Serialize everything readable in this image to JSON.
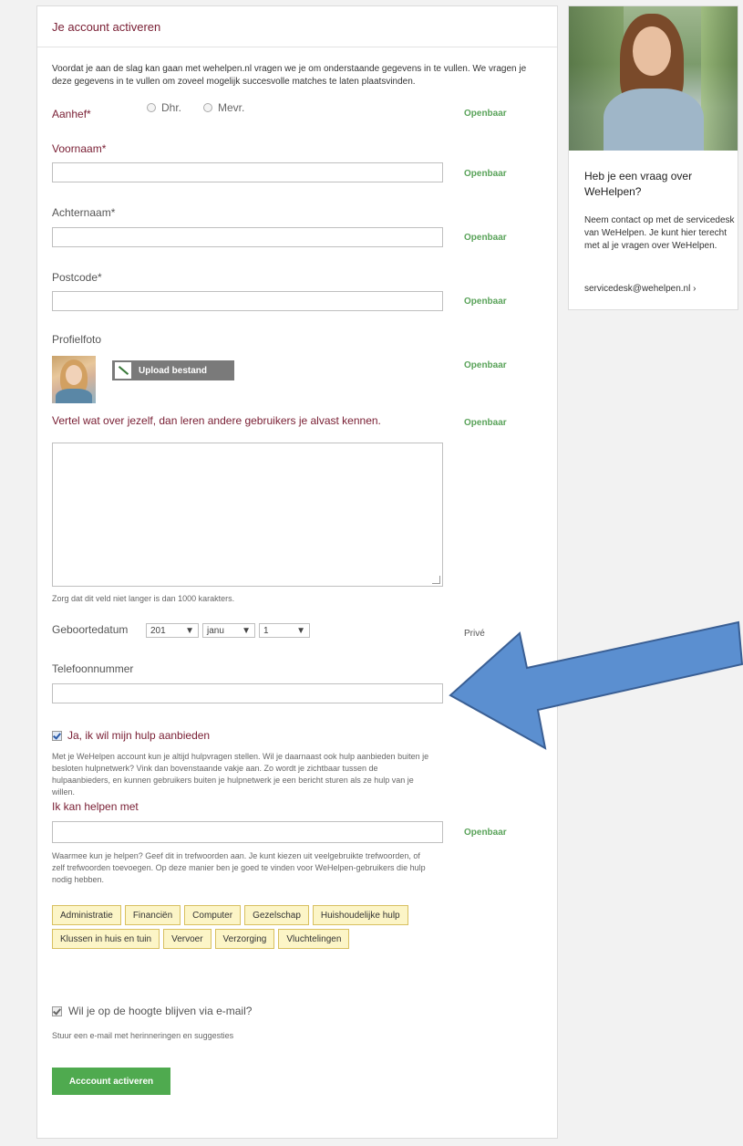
{
  "form": {
    "title": "Je account activeren",
    "intro": "Voordat je aan de slag kan gaan met wehelpen.nl vragen we je om onderstaande gegevens in te vullen. We vragen je deze gegevens in te vullen om zoveel mogelijk succesvolle matches te laten plaatsvinden.",
    "public_label": "Openbaar",
    "private_label": "Privé",
    "salutation": {
      "label": "Aanhef*",
      "options": [
        "Dhr.",
        "Mevr."
      ]
    },
    "first_name": {
      "label": "Voornaam*",
      "value": ""
    },
    "last_name": {
      "label": "Achternaam*",
      "value": ""
    },
    "postcode": {
      "label": "Postcode*",
      "value": ""
    },
    "photo": {
      "label": "Profielfoto",
      "upload_label": "Upload bestand"
    },
    "about": {
      "label": "Vertel wat over jezelf, dan leren andere gebruikers je alvast kennen.",
      "hint": "Zorg dat dit veld niet langer is dan 1000 karakters.",
      "value": ""
    },
    "birthdate": {
      "label": "Geboortedatum",
      "year": "201",
      "month": "janu",
      "day": "1"
    },
    "phone": {
      "label": "Telefoonnummer",
      "value": "",
      "visibility_partial": "P"
    },
    "offer_help": {
      "label": "Ja, ik wil mijn hulp aanbieden",
      "checked": true,
      "description": "Met je WeHelpen account kun je altijd hulpvragen stellen. Wil je daarnaast ook hulp aanbieden buiten je besloten hulpnetwerk? Vink dan bovenstaande vakje aan. Zo wordt je zichtbaar tussen de hulpaanbieders, en kunnen gebruikers buiten je hulpnetwerk je een bericht sturen als ze hulp van je willen."
    },
    "help_with": {
      "label": "Ik kan helpen met",
      "value": "",
      "hint": "Waarmee kun je helpen? Geef dit in trefwoorden aan. Je kunt kiezen uit veelgebruikte trefwoorden, of zelf trefwoorden toevoegen. Op deze manier ben je goed te vinden voor WeHelpen-gebruikers die hulp nodig hebben.",
      "tags_row1": [
        "Administratie",
        "Financiën",
        "Computer",
        "Gezelschap",
        "Huishoudelijke hulp"
      ],
      "tags_row2": [
        "Klussen in huis en tuin",
        "Vervoer",
        "Verzorging",
        "Vluchtelingen"
      ]
    },
    "email_updates": {
      "label": "Wil je op de hoogte blijven via e-mail?",
      "hint": "Stuur een e-mail met herinneringen en suggesties",
      "checked": true
    },
    "submit_label": "Acccount activeren"
  },
  "sidebar": {
    "heading": "Heb je een vraag over WeHelpen?",
    "text": "Neem contact op met de servicedesk van WeHelpen. Je kunt hier terecht met al je vragen over WeHelpen.",
    "email": "servicedesk@wehelpen.nl",
    "email_suffix": "›"
  },
  "colors": {
    "accent_title": "#7a2035",
    "public_green": "#5aa35a",
    "button_green": "#4faa4f",
    "tag_fill": "#fcf5c7",
    "arrow_blue": "#5b8fd0"
  },
  "icons": {
    "upload": "pencil-icon",
    "arrow": "arrow-annotation-icon"
  }
}
